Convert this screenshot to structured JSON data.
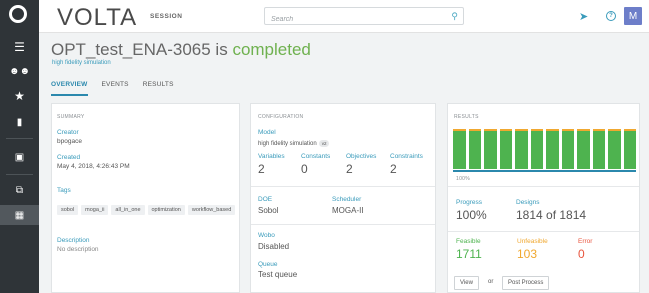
{
  "header": {
    "brand": "VOLTA",
    "section": "SESSION",
    "search_placeholder": "Search",
    "avatar_initial": "M",
    "help_icon": "?"
  },
  "page": {
    "title_name": "OPT_test_ENA-3065",
    "title_mid": " is ",
    "title_status": "completed",
    "subtitle": "high fidelity simulation",
    "tabs": [
      "OVERVIEW",
      "EVENTS",
      "RESULTS"
    ]
  },
  "summary": {
    "label": "SUMMARY",
    "creator_label": "Creator",
    "creator_value": "bpogace",
    "created_label": "Created",
    "created_value": "May 4, 2018, 4:26:43 PM",
    "tags_label": "Tags",
    "tags": [
      "sobol",
      "moga_ii",
      "all_in_one",
      "optimization",
      "workflow_based"
    ],
    "description_label": "Description",
    "description_value": "No description"
  },
  "configuration": {
    "label": "CONFIGURATION",
    "model_label": "Model",
    "model_value": "high fidelity simulation",
    "model_version": "v2",
    "variables_label": "Variables",
    "variables_value": "2",
    "constants_label": "Constants",
    "constants_value": "0",
    "objectives_label": "Objectives",
    "objectives_value": "2",
    "constraints_label": "Constraints",
    "constraints_value": "2",
    "doe_label": "DOE",
    "doe_value": "Sobol",
    "scheduler_label": "Scheduler",
    "scheduler_value": "MOGA-II",
    "wobo_label": "Wobo",
    "wobo_value": "Disabled",
    "queue_label": "Queue",
    "queue_value": "Test queue"
  },
  "results": {
    "label": "RESULTS",
    "chart_axis_label": "100%",
    "bar_count": 12,
    "progress_label": "Progress",
    "progress_value": "100%",
    "designs_label": "Designs",
    "designs_value": "1814 of 1814",
    "feasible_label": "Feasible",
    "feasible_value": "1711",
    "unfeasible_label": "Unfeasible",
    "unfeasible_value": "103",
    "error_label": "Error",
    "error_value": "0",
    "view_button": "View",
    "or_text": "or",
    "post_process_button": "Post Process"
  },
  "colors": {
    "completed": "#6fb14f",
    "feasible": "#4eb34f",
    "unfeasible": "#f0a830",
    "error": "#e8553e",
    "accent": "#3a9bbb"
  }
}
